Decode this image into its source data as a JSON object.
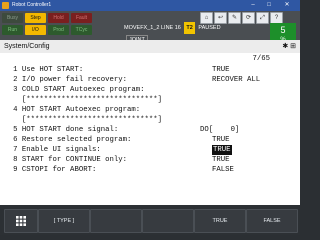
{
  "window": {
    "title": "Robot Controller1"
  },
  "status": {
    "leds": [
      {
        "label": "Busy",
        "state": "dim"
      },
      {
        "label": "Step",
        "state": "on"
      },
      {
        "label": "Hold",
        "state": "red"
      },
      {
        "label": "Fault",
        "state": "red"
      },
      {
        "label": "Run",
        "state": "green"
      },
      {
        "label": "I/O",
        "state": "on"
      },
      {
        "label": "Prod",
        "state": "green"
      },
      {
        "label": "TCyc",
        "state": "green"
      }
    ],
    "program": "MOVEFX_1_2 LINE 16",
    "mode_badge": "T2",
    "run_state": "PAUSED",
    "coord": "JOINT",
    "override_value": "5",
    "override_unit": "%"
  },
  "breadcrumb": {
    "text": "System/Config",
    "icons": "✱ ⊞"
  },
  "config": {
    "pager": "7/65",
    "rows": [
      {
        "text": "   1 Use HOT START:",
        "value": "TRUE"
      },
      {
        "text": "   2 I/O power fail recovery:",
        "value": "RECOVER ALL"
      },
      {
        "text": "   3 COLD START Autoexec program:",
        "value": ""
      },
      {
        "text": "     [******************************]",
        "value": ""
      },
      {
        "text": "   4 HOT START Autoexec program:",
        "value": ""
      },
      {
        "text": "     [******************************]",
        "value": ""
      },
      {
        "text": "   5 HOT START done signal:",
        "value": "DO[    0]"
      },
      {
        "text": "   6 Restore selected program:",
        "value": "TRUE"
      },
      {
        "text": "   7 Enable UI signals:",
        "value": "TRUE"
      },
      {
        "text": "   8 START for CONTINUE only:",
        "value": "TRUE"
      },
      {
        "text": "   9 CSTOPI for ABORT:",
        "value": "FALSE"
      }
    ]
  },
  "fkeys": {
    "menu_icon": "grid-icon",
    "f1": "[ TYPE ]",
    "f4": "TRUE",
    "f5": "FALSE"
  }
}
